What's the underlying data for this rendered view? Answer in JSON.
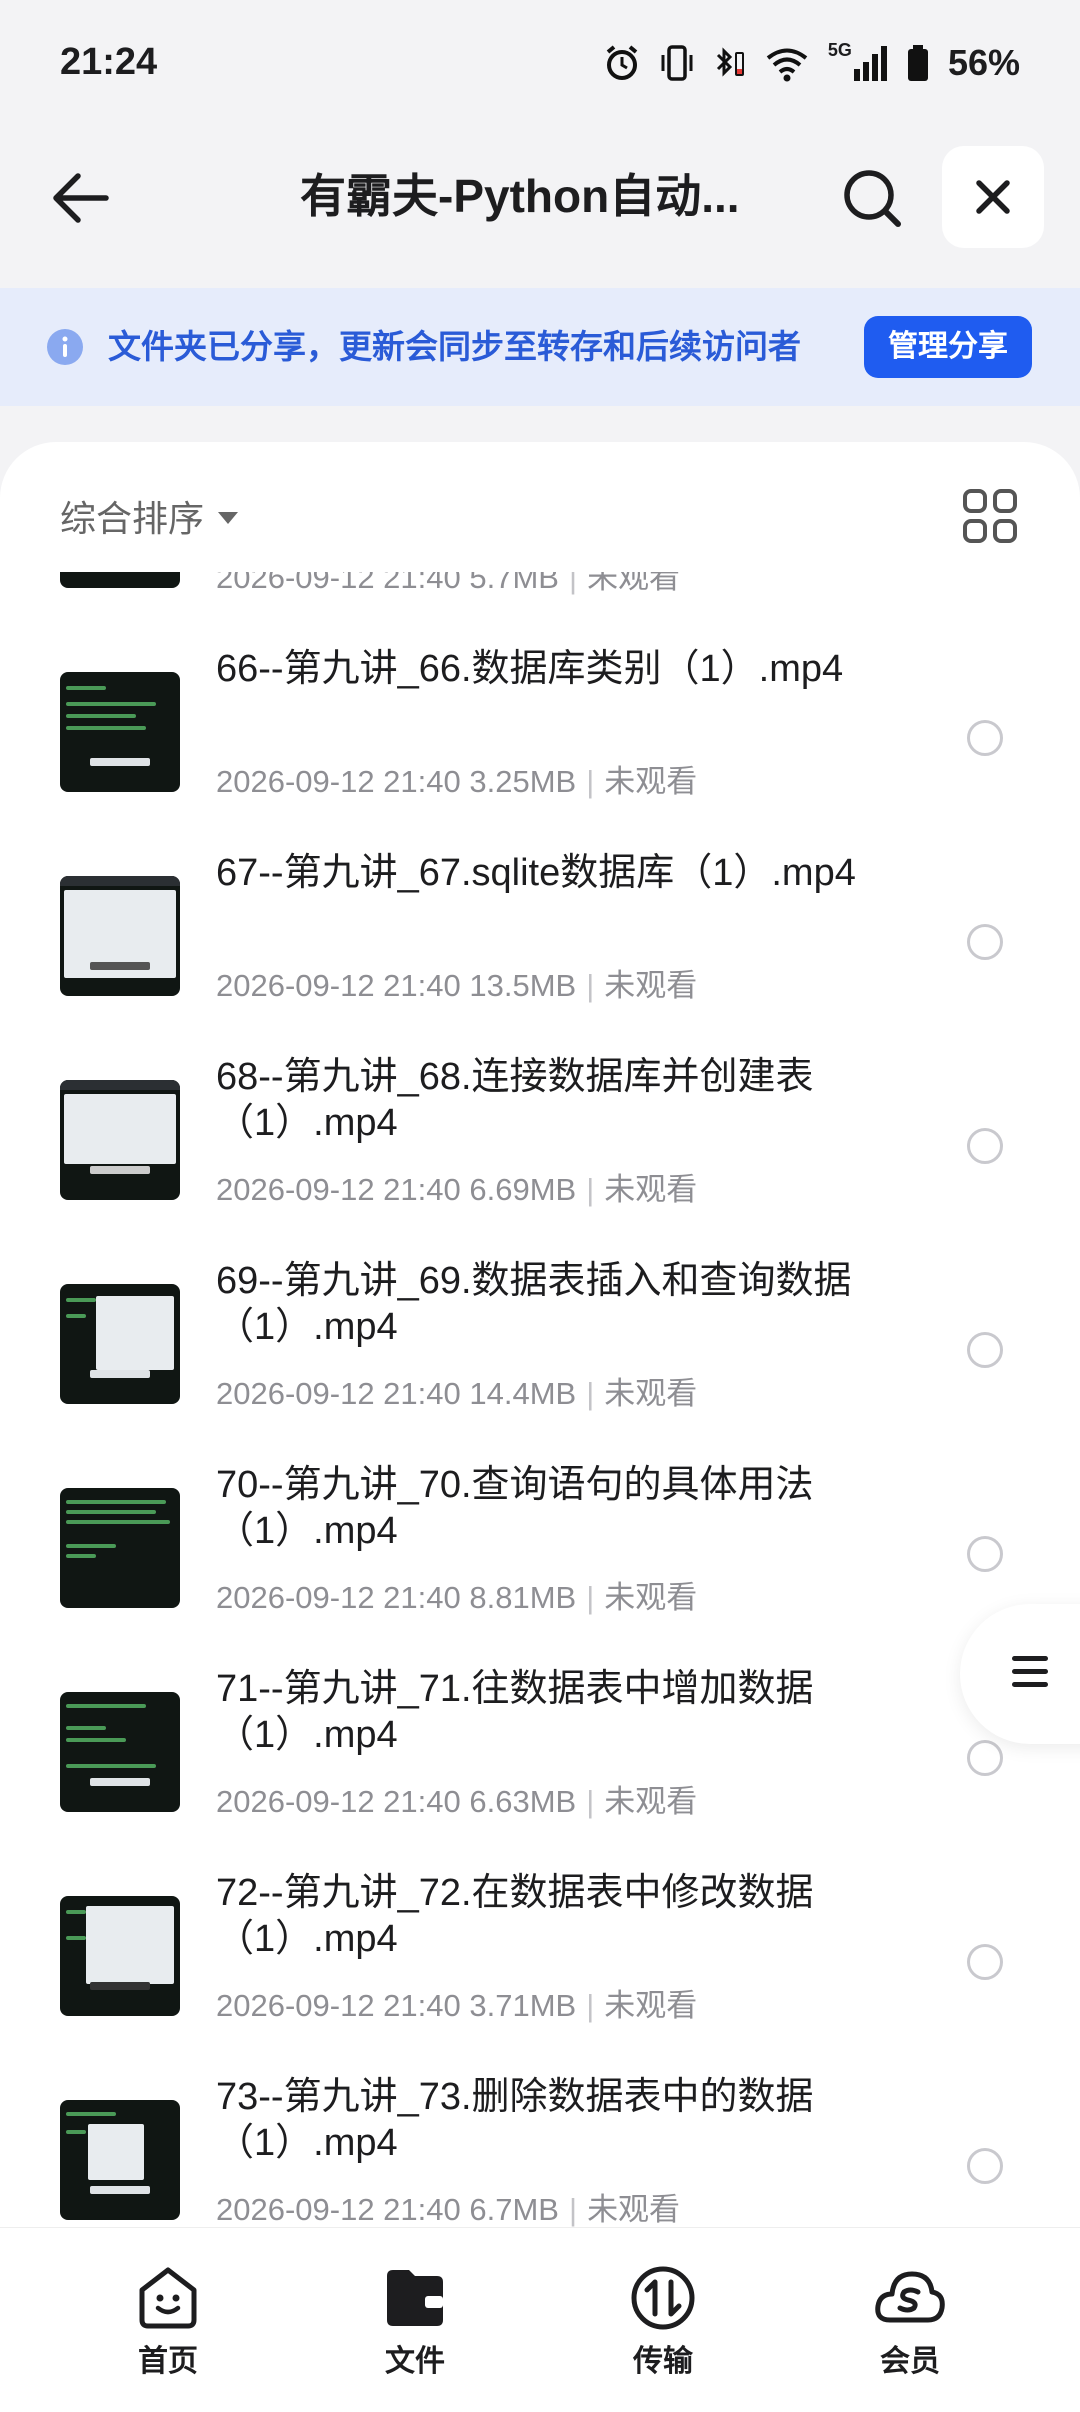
{
  "status_bar": {
    "time": "21:24",
    "network": "5G",
    "battery": "56%"
  },
  "header": {
    "title": "有霸夫-Python自动..."
  },
  "share_banner": {
    "text": "文件夹已分享，更新会同步至转存和后续访问者",
    "button_label": "管理分享"
  },
  "toolbar": {
    "sort_label": "综合排序"
  },
  "files": [
    {
      "name": "",
      "date": "2026-09-12 21:40",
      "size": "5.7MB",
      "status": "未观看"
    },
    {
      "name": "66--第九讲_66.数据库类别（1）.mp4",
      "date": "2026-09-12 21:40",
      "size": "3.25MB",
      "status": "未观看"
    },
    {
      "name": "67--第九讲_67.sqlite数据库（1）.mp4",
      "date": "2026-09-12 21:40",
      "size": "13.5MB",
      "status": "未观看"
    },
    {
      "name": "68--第九讲_68.连接数据库并创建表（1）.mp4",
      "date": "2026-09-12 21:40",
      "size": "6.69MB",
      "status": "未观看"
    },
    {
      "name": "69--第九讲_69.数据表插入和查询数据（1）.mp4",
      "date": "2026-09-12 21:40",
      "size": "14.4MB",
      "status": "未观看"
    },
    {
      "name": "70--第九讲_70.查询语句的具体用法（1）.mp4",
      "date": "2026-09-12 21:40",
      "size": "8.81MB",
      "status": "未观看"
    },
    {
      "name": "71--第九讲_71.往数据表中增加数据（1）.mp4",
      "date": "2026-09-12 21:40",
      "size": "6.63MB",
      "status": "未观看"
    },
    {
      "name": "72--第九讲_72.在数据表中修改数据（1）.mp4",
      "date": "2026-09-12 21:40",
      "size": "3.71MB",
      "status": "未观看"
    },
    {
      "name": "73--第九讲_73.删除数据表中的数据（1）.mp4",
      "date": "2026-09-12 21:40",
      "size": "6.7MB",
      "status": "未观看"
    }
  ],
  "bottom_nav": {
    "items": [
      {
        "label": "首页",
        "icon": "home-face-icon"
      },
      {
        "label": "文件",
        "icon": "folder-wallet-icon"
      },
      {
        "label": "传输",
        "icon": "transfer-icon"
      },
      {
        "label": "会员",
        "icon": "vip-cloud-icon"
      }
    ]
  },
  "colors": {
    "accent": "#1f5cf0",
    "banner_bg": "#e6ecfb",
    "banner_text": "#2a5bd7"
  }
}
